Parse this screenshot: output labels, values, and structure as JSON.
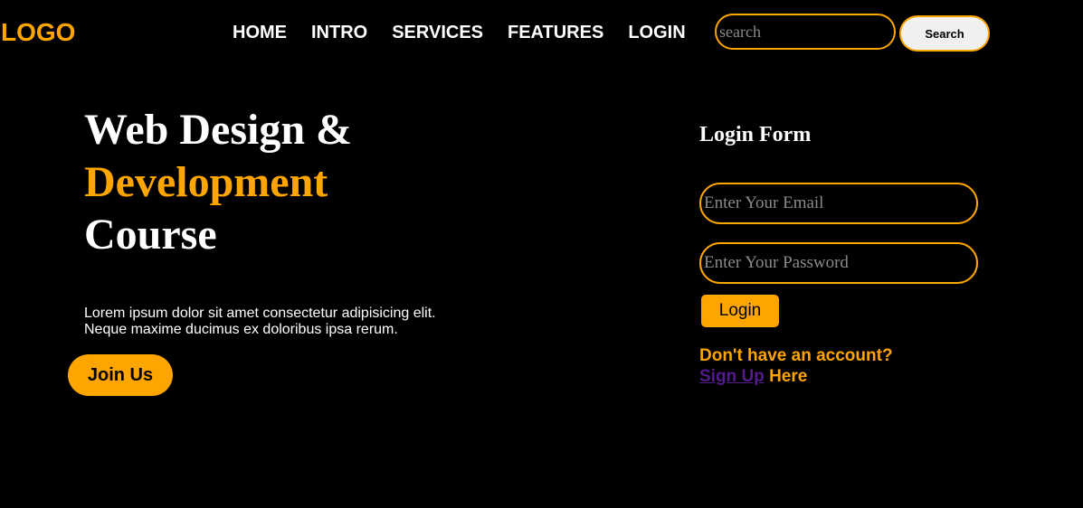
{
  "header": {
    "logo": "LOGO",
    "nav": [
      {
        "label": "HOME"
      },
      {
        "label": "INTRO"
      },
      {
        "label": "SERVICES"
      },
      {
        "label": "FEATURES"
      },
      {
        "label": "LOGIN"
      }
    ],
    "search": {
      "placeholder": "search",
      "value": "",
      "button_label": "Search"
    }
  },
  "hero": {
    "title_line1": "Web Design &",
    "title_line2": "Development",
    "title_line3": "Course",
    "description_line1": "Lorem ipsum dolor sit amet consectetur adipisicing elit.",
    "description_line2": "Neque maxime ducimus ex doloribus ipsa rerum.",
    "cta_label": "Join Us"
  },
  "login_form": {
    "title": "Login Form",
    "email_placeholder": "Enter Your Email",
    "email_value": "",
    "password_placeholder": "Enter Your Password",
    "password_value": "",
    "submit_label": "Login",
    "no_account_text": "Don't have an account?",
    "signup_link": "Sign Up",
    "signup_suffix": "Here"
  },
  "colors": {
    "background": "#000000",
    "accent": "#FFA500",
    "text": "#FFFFFF",
    "link": "#551A8B"
  }
}
